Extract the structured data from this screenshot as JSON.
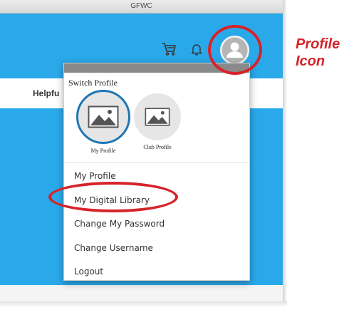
{
  "window": {
    "title": "GFWC"
  },
  "header": {
    "cart_icon": "shopping-cart-icon",
    "bell_icon": "bell-icon",
    "avatar_icon": "user-avatar-icon"
  },
  "nav": {
    "helpful_label": "Helpfu"
  },
  "dropdown": {
    "switch_title": "Switch Profile",
    "profiles": [
      {
        "label": "My Profile",
        "active": true,
        "icon": "image-placeholder-icon"
      },
      {
        "label": "Club Profile",
        "active": false,
        "icon": "image-placeholder-icon"
      }
    ],
    "menu": [
      {
        "label": "My Profile"
      },
      {
        "label": "My Digital Library"
      },
      {
        "label": "Change My Password"
      },
      {
        "label": "Change Username"
      },
      {
        "label": "Logout"
      }
    ]
  },
  "annotation": {
    "callout_line1": "Profile",
    "callout_line2": "Icon",
    "color": "#d6232a"
  },
  "colors": {
    "header_blue": "#2aa9ea",
    "active_ring": "#1e76b4"
  }
}
